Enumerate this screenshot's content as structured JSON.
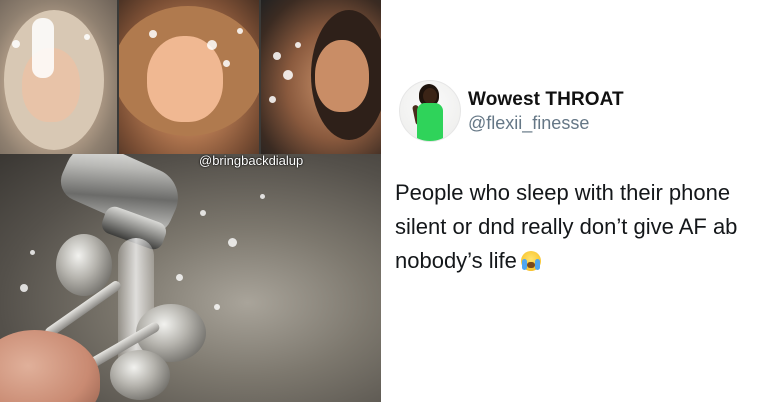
{
  "meme": {
    "watermark": "@bringbackdialup"
  },
  "tweet": {
    "display_name": "Wowest THROAT",
    "username": "@flexii_finesse",
    "text_lines": [
      "People who sleep with their phone",
      "silent or dnd really don’t give AF ab",
      "nobody’s life"
    ],
    "emoji": "loudly-crying-face",
    "colors": {
      "name": "#111111",
      "handle": "#657786",
      "text": "#14171a",
      "avatar_dress": "#2fd35a"
    }
  }
}
